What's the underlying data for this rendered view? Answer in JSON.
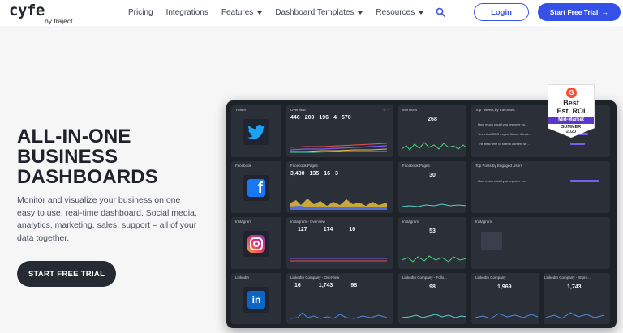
{
  "logo": {
    "main": "cyfe",
    "sub": "by traject"
  },
  "nav": {
    "items": [
      {
        "label": "Pricing"
      },
      {
        "label": "Integrations"
      },
      {
        "label": "Features"
      },
      {
        "label": "Dashboard Templates"
      },
      {
        "label": "Resources"
      }
    ],
    "login": "Login",
    "trial": "Start Free Trial",
    "trial_arrow": "→"
  },
  "hero": {
    "title_lines": [
      "ALL-IN-ONE",
      "BUSINESS",
      "DASHBOARDS"
    ],
    "text": "Monitor and visualize your business on one easy to use, real-time dashboard. Social media, analytics, marketing, sales, support – all of your data together.",
    "cta": "START FREE TRIAL"
  },
  "badge": {
    "logo": "G",
    "line1": "Best",
    "line2": "Est. ROI",
    "band": "Mid-Market",
    "line3": "SUMMER",
    "line4": "2020"
  },
  "dashboard": {
    "twitter": {
      "title": "Twitter"
    },
    "facebook": {
      "title": "Facebook"
    },
    "instagram": {
      "title": "Instagram"
    },
    "linkedin": {
      "title": "LinkedIn"
    },
    "overview": {
      "title": "Overview",
      "stats": [
        "446",
        "209",
        "196",
        "4",
        "570"
      ]
    },
    "mentions": {
      "title": "Mentions",
      "value": "268"
    },
    "top_tweets": {
      "title": "Top Tweets by Favorites",
      "rows": [
        "How much could you improve yo...",
        "Technical SEO expert Nancy Jonat...",
        "The best time to start a content str..."
      ]
    },
    "fb_pages": {
      "title": "Facebook Pages",
      "stats": [
        "3,430",
        "135",
        "16",
        "3"
      ]
    },
    "fb_pages2": {
      "title": "Facebook Pages",
      "value": "30"
    },
    "top_posts": {
      "title": "Top Posts by Engaged Users",
      "rows": [
        "How much could you improve yo..."
      ]
    },
    "ig_overview": {
      "title": "Instagram - Overview",
      "stats": [
        "127",
        "174",
        "16"
      ]
    },
    "ig_metric": {
      "title": "Instagram",
      "value": "53"
    },
    "ig_table": {
      "title": "Instagram"
    },
    "li_overview": {
      "title": "LinkedIn Company - Overview",
      "stats": [
        "16",
        "1,743",
        "98"
      ]
    },
    "li_follow": {
      "title": "LinkedIn Company - Follo...",
      "value": "98"
    },
    "li_company": {
      "title": "LinkedIn Company",
      "value": "1,969"
    },
    "li_impr": {
      "title": "LinkedIn Company - Impre...",
      "value": "1,743"
    }
  },
  "colors": {
    "accent": "#3551e8",
    "twitter": "#1da1f2",
    "facebook": "#1877f2",
    "linkedin": "#0a66c2"
  }
}
